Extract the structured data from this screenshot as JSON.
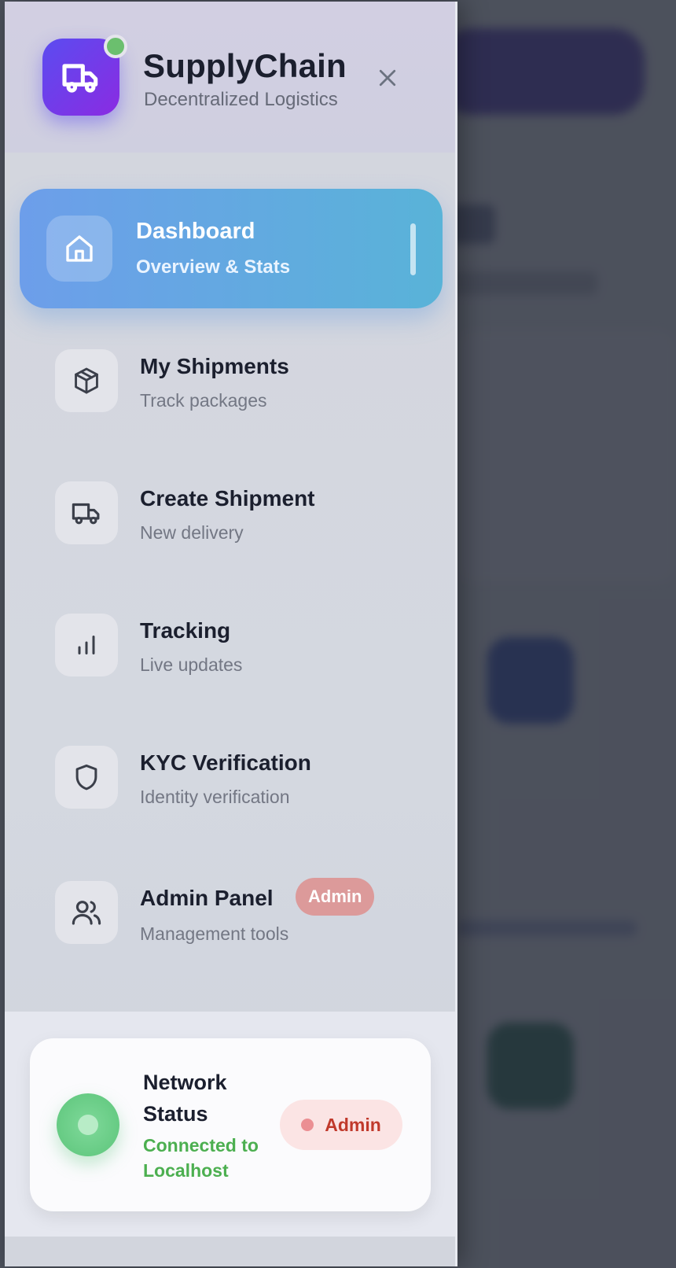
{
  "brand": {
    "name": "SupplyChain",
    "subtitle": "Decentralized Logistics",
    "logo_icon": "truck-icon",
    "online_color": "#6bbf6e"
  },
  "nav": {
    "items": [
      {
        "label": "Dashboard",
        "description": "Overview & Stats",
        "icon": "home-icon",
        "active": true
      },
      {
        "label": "My Shipments",
        "description": "Track packages",
        "icon": "package-icon"
      },
      {
        "label": "Create Shipment",
        "description": "New delivery",
        "icon": "truck-icon"
      },
      {
        "label": "Tracking",
        "description": "Live updates",
        "icon": "bar-chart-icon"
      },
      {
        "label": "KYC Verification",
        "description": "Identity verification",
        "icon": "shield-icon"
      },
      {
        "label": "Admin Panel",
        "description": "Management tools",
        "icon": "users-icon",
        "badge": "Admin"
      }
    ]
  },
  "network_status": {
    "title": "Network Status",
    "subtitle": "Connected to Localhost",
    "role": "Admin",
    "connected_color": "#4caf50",
    "role_color": "#c0392b"
  },
  "colors": {
    "accent_gradient_start": "#6d9eea",
    "accent_gradient_end": "#59b3d8",
    "logo_gradient_start": "#5b4cf0",
    "logo_gradient_end": "#8a2be2"
  }
}
